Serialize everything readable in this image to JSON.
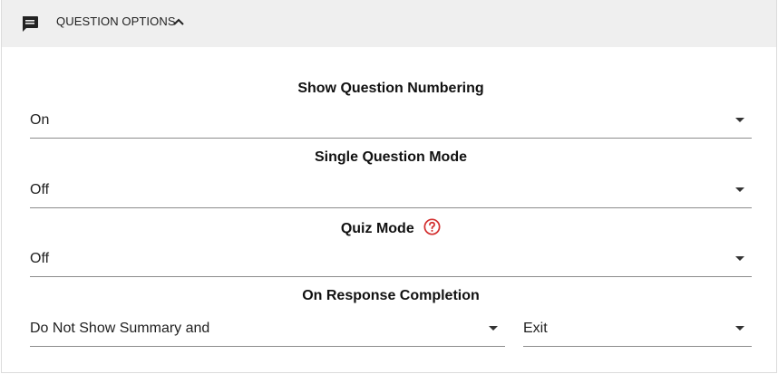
{
  "header": {
    "title": "QUESTION OPTIONS",
    "icon": "comment-icon",
    "toggle_icon": "chevron-up-icon"
  },
  "fields": {
    "numbering": {
      "label": "Show Question Numbering",
      "value": "On"
    },
    "single_mode": {
      "label": "Single Question Mode",
      "value": "Off"
    },
    "quiz_mode": {
      "label": "Quiz Mode",
      "value": "Off",
      "help_icon": "help-circle-icon",
      "help_color": "#d32f2f"
    },
    "completion": {
      "label": "On Response Completion",
      "value_left": "Do Not Show Summary and",
      "value_right": "Exit"
    }
  }
}
